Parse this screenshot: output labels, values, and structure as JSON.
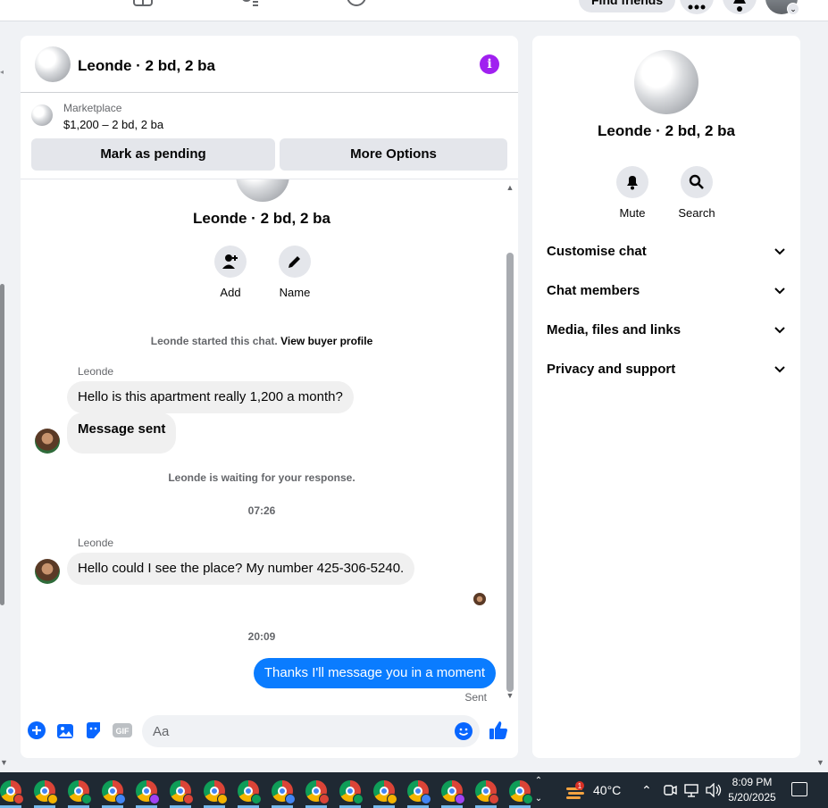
{
  "topnav": {
    "find_friends": "Find friends"
  },
  "chat": {
    "title": "Leonde · 2 bd, 2 ba",
    "marketplace_label": "Marketplace",
    "listing_price": "$1,200 – 2 bd, 2 ba",
    "mark_pending": "Mark as pending",
    "more_options": "More Options",
    "intro_title": "Leonde · 2 bd, 2 ba",
    "add_label": "Add",
    "name_label": "Name",
    "started_text": "Leonde started this chat.",
    "view_profile": "View buyer profile",
    "messages": [
      {
        "sender": "Leonde",
        "text": "Hello is this apartment really 1,200 a month?"
      },
      {
        "text": "Message sent"
      },
      {
        "sender": "Leonde",
        "text": "Hello could I see the place? My number 425-306-5240."
      }
    ],
    "waiting_text": "Leonde is waiting for your response.",
    "time_1": "07:26",
    "time_2": "20:09",
    "my_message": "Thanks I'll message you in a moment",
    "sent_label": "Sent",
    "input_placeholder": "Aa"
  },
  "side": {
    "title": "Leonde · 2 bd, 2 ba",
    "mute_label": "Mute",
    "search_label": "Search",
    "sections": [
      "Customise chat",
      "Chat members",
      "Media, files and links",
      "Privacy and support"
    ]
  },
  "taskbar": {
    "temperature": "40°C",
    "weather_badge": "1",
    "time": "8:09 PM",
    "date": "5/20/2025"
  },
  "colors": {
    "messenger_blue": "#0a7cff",
    "info_purple": "#a020f0",
    "like_blue": "#0866ff"
  }
}
